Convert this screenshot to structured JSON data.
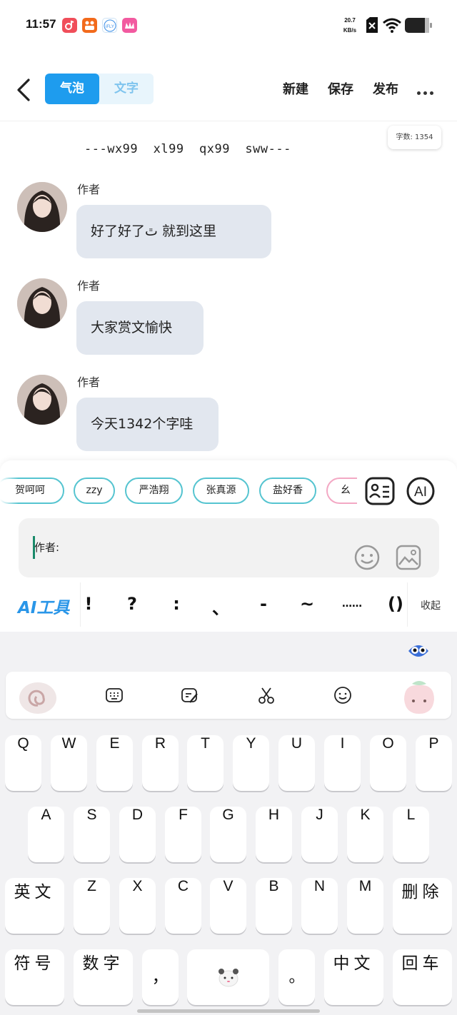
{
  "status_bar": {
    "time": "11:57",
    "net_speed_value": "20.7",
    "net_speed_unit": "KB/s"
  },
  "toolbar": {
    "tab_bubble": "气泡",
    "tab_text": "文字",
    "new_label": "新建",
    "save_label": "保存",
    "publish_label": "发布"
  },
  "word_count": "字数: 1354",
  "headline": "---wx99  xl99  qx99  sww---",
  "messages": [
    {
      "author": "作者",
      "text": "好了好了ﭢ 就到这里"
    },
    {
      "author": "作者",
      "text": "大家赏文愉快"
    },
    {
      "author": "作者",
      "text": "今天1342个字哇"
    }
  ],
  "chips": [
    "贺呵呵",
    "zzy",
    "严浩翔",
    "张真源",
    "盐好香",
    "幺"
  ],
  "composer": {
    "input_value": "作者:",
    "ai_tools_label": "AI工具",
    "collapse_label": "收起"
  },
  "punctuation": [
    "!",
    "?",
    ":",
    "、",
    "-",
    "~",
    "……",
    "()"
  ],
  "keyboard": {
    "row1": [
      "Q",
      "W",
      "E",
      "R",
      "T",
      "Y",
      "U",
      "I",
      "O",
      "P"
    ],
    "row2": [
      "A",
      "S",
      "D",
      "F",
      "G",
      "H",
      "J",
      "K",
      "L"
    ],
    "row3": [
      "英文",
      "Z",
      "X",
      "C",
      "V",
      "B",
      "N",
      "M",
      "删除"
    ],
    "row4": [
      "符号",
      "数字",
      "，",
      "",
      "。",
      "中文",
      "回车"
    ]
  },
  "colors": {
    "accent": "#1e9cee",
    "chip_border": "#55c4d0",
    "bubble": "#e2e7ef"
  }
}
